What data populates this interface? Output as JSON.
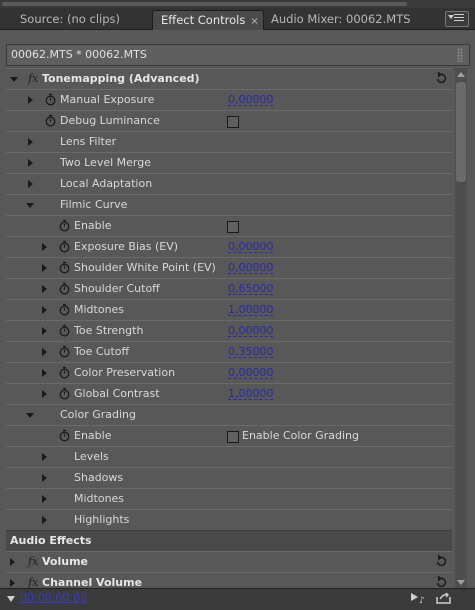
{
  "tabs": [
    {
      "label": "Source: (no clips)",
      "active": false
    },
    {
      "label": "Effect Controls",
      "active": true,
      "close": "×"
    },
    {
      "label": "Audio Mixer: 00062.MTS",
      "active": false
    }
  ],
  "clip_path": "00062.MTS * 00062.MTS",
  "rows": [
    {
      "type": "effect",
      "label": "Tonemapping (Advanced)",
      "fx": "fx",
      "expanded": true,
      "reset": true
    },
    {
      "type": "param",
      "indent": 1,
      "arrow": "right",
      "stopwatch": true,
      "label": "Manual Exposure",
      "value": "0,00000"
    },
    {
      "type": "param",
      "indent": 1,
      "arrow": "none",
      "stopwatch": true,
      "label": "Debug Luminance",
      "checkbox": true
    },
    {
      "type": "group",
      "indent": 1,
      "arrow": "right",
      "label": "Lens Filter"
    },
    {
      "type": "group",
      "indent": 1,
      "arrow": "right",
      "label": "Two Level Merge"
    },
    {
      "type": "group",
      "indent": 1,
      "arrow": "right",
      "label": "Local Adaptation"
    },
    {
      "type": "group",
      "indent": 1,
      "arrow": "down",
      "label": "Filmic Curve"
    },
    {
      "type": "param",
      "indent": 2,
      "arrow": "none",
      "stopwatch": true,
      "label": "Enable",
      "checkbox": true
    },
    {
      "type": "param",
      "indent": 2,
      "arrow": "right",
      "stopwatch": true,
      "label": "Exposure Bias (EV)",
      "value": "0,00000"
    },
    {
      "type": "param",
      "indent": 2,
      "arrow": "right",
      "stopwatch": true,
      "label": "Shoulder White Point (EV)",
      "value": "0,00000"
    },
    {
      "type": "param",
      "indent": 2,
      "arrow": "right",
      "stopwatch": true,
      "label": "Shoulder Cutoff",
      "value": "0,65000"
    },
    {
      "type": "param",
      "indent": 2,
      "arrow": "right",
      "stopwatch": true,
      "label": "Midtones",
      "value": "1,00000"
    },
    {
      "type": "param",
      "indent": 2,
      "arrow": "right",
      "stopwatch": true,
      "label": "Toe Strength",
      "value": "0,00000"
    },
    {
      "type": "param",
      "indent": 2,
      "arrow": "right",
      "stopwatch": true,
      "label": "Toe Cutoff",
      "value": "0,35000"
    },
    {
      "type": "param",
      "indent": 2,
      "arrow": "right",
      "stopwatch": true,
      "label": "Color Preservation",
      "value": "0,00000"
    },
    {
      "type": "param",
      "indent": 2,
      "arrow": "right",
      "stopwatch": true,
      "label": "Global Contrast",
      "value": "1,00000"
    },
    {
      "type": "group",
      "indent": 1,
      "arrow": "down",
      "label": "Color Grading"
    },
    {
      "type": "param",
      "indent": 2,
      "arrow": "none",
      "stopwatch": true,
      "label": "Enable",
      "checkbox": true,
      "checkbox_label": "Enable Color Grading"
    },
    {
      "type": "group",
      "indent": 2,
      "arrow": "right",
      "label": "Levels"
    },
    {
      "type": "group",
      "indent": 2,
      "arrow": "right",
      "label": "Shadows"
    },
    {
      "type": "group",
      "indent": 2,
      "arrow": "right",
      "label": "Midtones"
    },
    {
      "type": "group",
      "indent": 2,
      "arrow": "right",
      "label": "Highlights"
    },
    {
      "type": "section",
      "label": "Audio Effects"
    },
    {
      "type": "effect",
      "label": "Volume",
      "fx": "fx",
      "expanded": false,
      "reset": true
    },
    {
      "type": "effect",
      "label": "Channel Volume",
      "fx": "fx",
      "expanded": false,
      "reset": true
    }
  ],
  "timecode": "00:00:00:00",
  "colors": {
    "panel_bg": "#585858",
    "value_link": "#2a2aa8",
    "timecode": "#3a3ac8"
  }
}
